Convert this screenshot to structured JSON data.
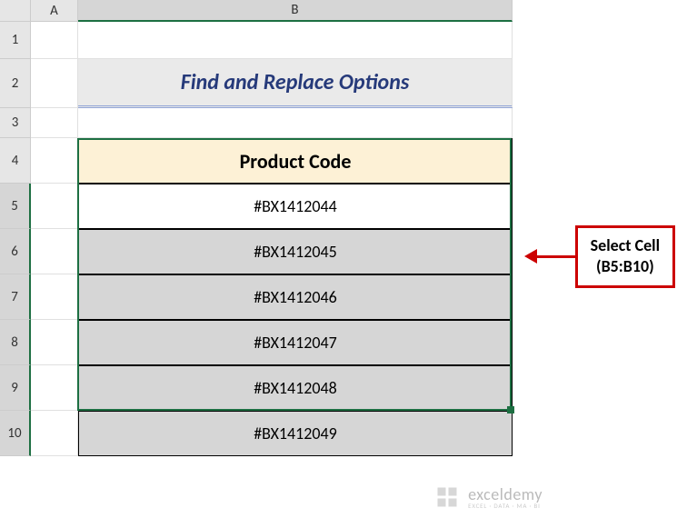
{
  "columns": {
    "A": "A",
    "B": "B"
  },
  "rows": {
    "r1": "1",
    "r2": "2",
    "r3": "3",
    "r4": "4",
    "r5": "5",
    "r6": "6",
    "r7": "7",
    "r8": "8",
    "r9": "9",
    "r10": "10"
  },
  "title": "Find and Replace Options",
  "table": {
    "header": "Product Code",
    "data": [
      "#BX1412044",
      "#BX1412045",
      "#BX1412046",
      "#BX1412047",
      "#BX1412048",
      "#BX1412049"
    ]
  },
  "callout": {
    "line1": "Select Cell",
    "line2": "(B5:B10)"
  },
  "watermark": {
    "title": "exceldemy",
    "sub": "EXCEL · DATA · MA · BI"
  },
  "chart_data": {
    "type": "table",
    "title": "Find and Replace Options",
    "columns": [
      "Product Code"
    ],
    "rows": [
      [
        "#BX1412044"
      ],
      [
        "#BX1412045"
      ],
      [
        "#BX1412046"
      ],
      [
        "#BX1412047"
      ],
      [
        "#BX1412048"
      ],
      [
        "#BX1412049"
      ]
    ]
  }
}
